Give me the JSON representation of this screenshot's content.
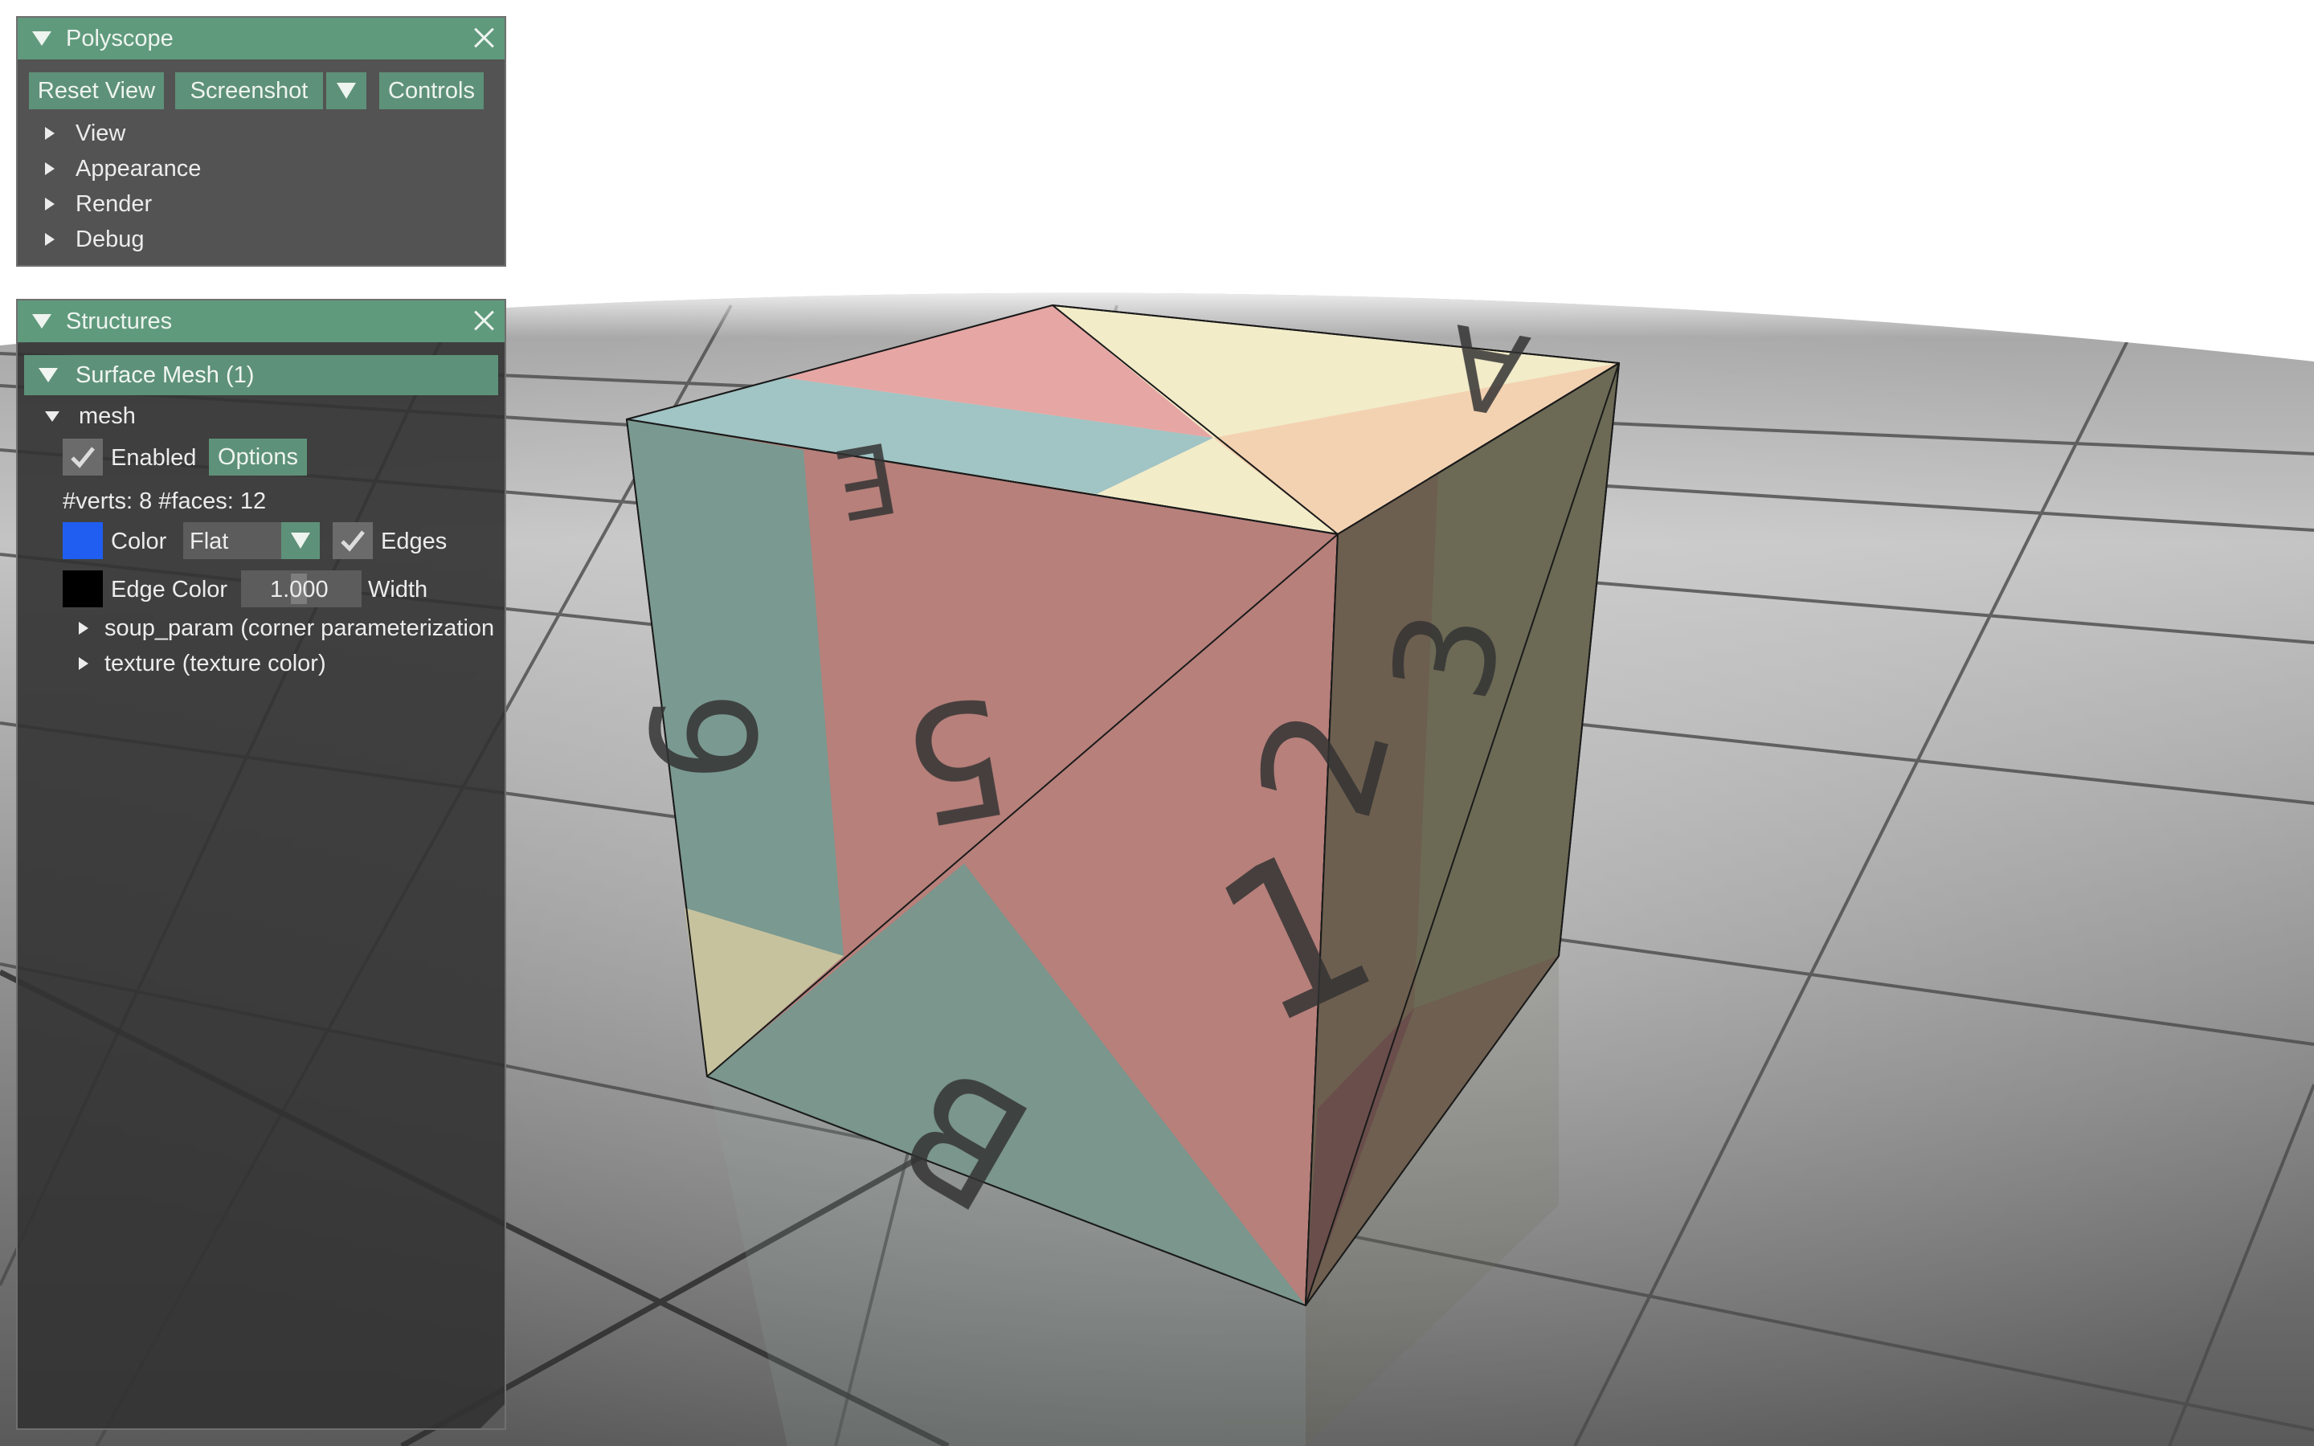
{
  "polyscope_panel": {
    "title": "Polyscope",
    "buttons": {
      "reset_view": "Reset View",
      "screenshot": "Screenshot",
      "controls": "Controls"
    },
    "sections": [
      "View",
      "Appearance",
      "Render",
      "Debug"
    ]
  },
  "structures_panel": {
    "title": "Structures",
    "group_header": "Surface Mesh (1)",
    "mesh": {
      "name": "mesh",
      "enabled_label": "Enabled",
      "enabled": true,
      "options_button": "Options",
      "stats": "#verts: 8  #faces: 12",
      "color_label": "Color",
      "color_value": "#1f5ef0",
      "shade_mode": "Flat",
      "edges_label": "Edges",
      "edges_enabled": true,
      "edge_color_label": "Edge Color",
      "edge_color_value": "#000000",
      "width_value": "1.000",
      "width_label": "Width",
      "quantities": [
        "soup_param (corner parameterization",
        "texture (texture color)"
      ]
    }
  },
  "scene": {
    "cube_face_letters": [
      "B",
      "A",
      "5",
      "E",
      "1",
      "2",
      "3",
      "9"
    ]
  }
}
